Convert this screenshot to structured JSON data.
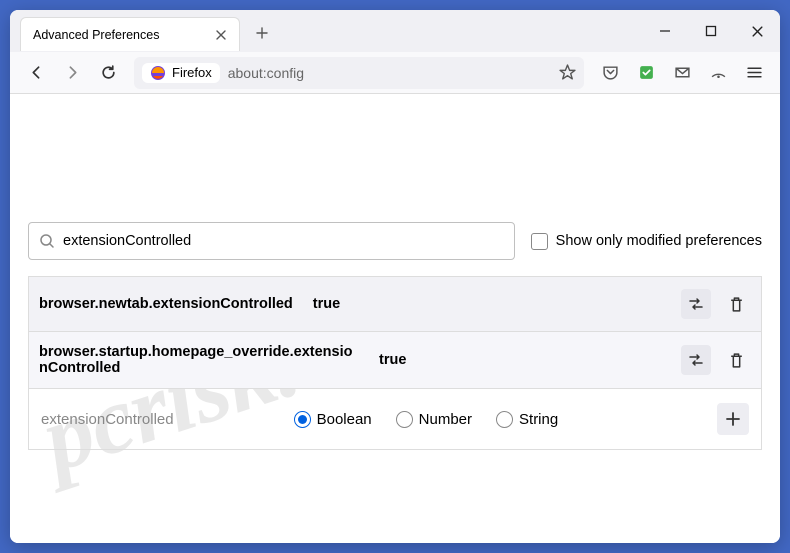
{
  "window": {
    "tab_title": "Advanced Preferences"
  },
  "urlbar": {
    "identity_label": "Firefox",
    "url": "about:config"
  },
  "search": {
    "value": "extensionControlled",
    "checkbox_label": "Show only modified preferences"
  },
  "prefs": [
    {
      "name": "browser.newtab.extensionControlled",
      "value": "true"
    },
    {
      "name": "browser.startup.homepage_override.extensionControlled",
      "value": "true"
    }
  ],
  "new_pref": {
    "name": "extensionControlled",
    "types": [
      "Boolean",
      "Number",
      "String"
    ],
    "selected": "Boolean"
  },
  "watermark": "pcrisk.com"
}
